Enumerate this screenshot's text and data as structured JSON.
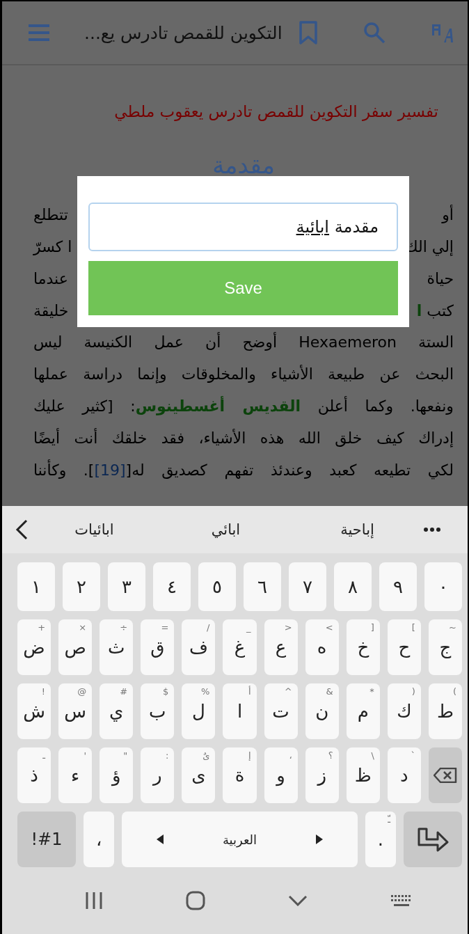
{
  "top_bar": {
    "title": "التكوين للقمص تادرس يع..."
  },
  "article": {
    "title": "تفسير سفر التكوين للقمص تادرس يعقوب ملطي",
    "heading": "مقدمة",
    "partial_lines": [
      {
        "right": [
          {
            "kind": "plain",
            "text": "أو"
          }
        ],
        "left": "تتطلع"
      },
      {
        "right": [
          {
            "kind": "plain",
            "text": "إلي الك"
          }
        ],
        "left": "ا كسرّ"
      },
      {
        "right": [
          {
            "kind": "plain",
            "text": "حياة"
          }
        ],
        "left": "عندما"
      },
      {
        "right": [
          {
            "kind": "plain",
            "text": "كتب "
          },
          {
            "kind": "saint",
            "text": "ا"
          }
        ],
        "left": "خليقة"
      }
    ],
    "lines": [
      [
        {
          "kind": "plain",
          "text": "الستة Hexaemeron أوضح أن عمل الكنيسة ليس"
        }
      ],
      [
        {
          "kind": "plain",
          "text": "البحث عن طبيعة الأشياء والمخلوقات وإنما دراسة عملها"
        }
      ],
      [
        {
          "kind": "plain",
          "text": "ونفعها. وكما أعلن "
        },
        {
          "kind": "saint",
          "text": "القديس أغسطينوس"
        },
        {
          "kind": "plain",
          "text": ": [كثير عليك"
        }
      ],
      [
        {
          "kind": "plain",
          "text": "إدراك كيف خلق الله هذه الأشياء، فقد خلقك أنت أيضًا"
        }
      ],
      [
        {
          "kind": "plain",
          "text": "لكي تطيعه كعبد وعندئذ تفهم كصديق له["
        },
        {
          "kind": "ref",
          "text": "[19]"
        },
        {
          "kind": "plain",
          "text": "]. وكأننا"
        }
      ]
    ]
  },
  "dialog": {
    "field": {
      "text": "مقدمة",
      "composing": "ابائية"
    },
    "button": "Save"
  },
  "keyboard": {
    "suggestions": [
      "إباحية",
      "ابائي",
      "ابائيات"
    ],
    "number_row": [
      {
        "kind": "char",
        "label": "٠"
      },
      {
        "kind": "char",
        "label": "٩"
      },
      {
        "kind": "char",
        "label": "٨"
      },
      {
        "kind": "char",
        "label": "٧"
      },
      {
        "kind": "char",
        "label": "٦"
      },
      {
        "kind": "char",
        "label": "٥"
      },
      {
        "kind": "char",
        "label": "٤"
      },
      {
        "kind": "char",
        "label": "٣"
      },
      {
        "kind": "char",
        "label": "٢"
      },
      {
        "kind": "char",
        "label": "١"
      }
    ],
    "rows": [
      [
        {
          "kind": "char",
          "label": "ج",
          "hint": "~"
        },
        {
          "kind": "char",
          "label": "ح",
          "hint": "]"
        },
        {
          "kind": "char",
          "label": "خ",
          "hint": "["
        },
        {
          "kind": "char",
          "label": "ه",
          "hint": ">"
        },
        {
          "kind": "char",
          "label": "ع",
          "hint": "<"
        },
        {
          "kind": "char",
          "label": "غ",
          "hint": "_"
        },
        {
          "kind": "char",
          "label": "ف",
          "hint": "/"
        },
        {
          "kind": "char",
          "label": "ق",
          "hint": "="
        },
        {
          "kind": "char",
          "label": "ث",
          "hint": "÷"
        },
        {
          "kind": "char",
          "label": "ص",
          "hint": "×"
        },
        {
          "kind": "char",
          "label": "ض",
          "hint": "+"
        }
      ],
      [
        {
          "kind": "char",
          "label": "ط",
          "hint": ")"
        },
        {
          "kind": "char",
          "label": "ك",
          "hint": "("
        },
        {
          "kind": "char",
          "label": "م",
          "hint": "*"
        },
        {
          "kind": "char",
          "label": "ن",
          "hint": "&"
        },
        {
          "kind": "char",
          "label": "ت",
          "hint": "^"
        },
        {
          "kind": "char",
          "label": "ا",
          "hint": "أ"
        },
        {
          "kind": "char",
          "label": "ل",
          "hint": "%"
        },
        {
          "kind": "char",
          "label": "ب",
          "hint": "$"
        },
        {
          "kind": "char",
          "label": "ي",
          "hint": "#"
        },
        {
          "kind": "char",
          "label": "س",
          "hint": "@"
        },
        {
          "kind": "char",
          "label": "ش",
          "hint": "!"
        }
      ],
      [
        {
          "kind": "backspace"
        },
        {
          "kind": "char",
          "label": "د",
          "hint": "`"
        },
        {
          "kind": "char",
          "label": "ظ",
          "hint": "\\"
        },
        {
          "kind": "char",
          "label": "ز",
          "hint": "؟"
        },
        {
          "kind": "char",
          "label": "و",
          "hint": "،"
        },
        {
          "kind": "char",
          "label": "ة",
          "hint": "إ"
        },
        {
          "kind": "char",
          "label": "ى",
          "hint": "ىٌ"
        },
        {
          "kind": "char",
          "label": "ر",
          "hint": ":"
        },
        {
          "kind": "char",
          "label": "ؤ",
          "hint": "\""
        },
        {
          "kind": "char",
          "label": "ء",
          "hint": "'"
        },
        {
          "kind": "char",
          "label": "ذ",
          "hint": "ـ"
        }
      ]
    ],
    "bottom_row": [
      {
        "kind": "enter"
      },
      {
        "kind": "char",
        "label": ".",
        "hint": "ـّ"
      },
      {
        "kind": "space",
        "label": "العربية"
      },
      {
        "kind": "char",
        "label": "،"
      },
      {
        "kind": "symbols",
        "label": "!#1"
      }
    ]
  }
}
